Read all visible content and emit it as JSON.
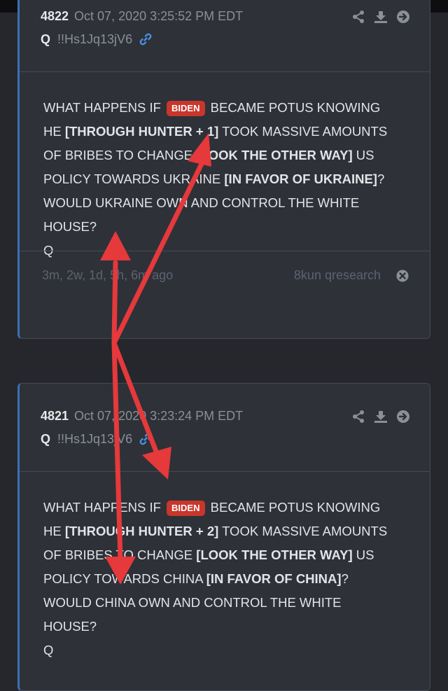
{
  "posts": [
    {
      "number": "4822",
      "date": "Oct 07, 2020 3:25:52 PM EDT",
      "author": "Q",
      "tripcode": "!!Hs1Jq13jV6",
      "body": {
        "l1_a": "WHAT HAPPENS IF",
        "badge": "BIDEN",
        "l1_b": "BECAME POTUS KNOWING",
        "l2_a": "HE",
        "l2_b": "[THROUGH HUNTER + 1]",
        "l2_c": "TOOK MASSIVE AMOUNTS",
        "l3_a": "OF BRIBES TO CHANGE",
        "l3_b": "[LOOK THE OTHER WAY]",
        "l3_c": "US",
        "l4_a": "POLICY TOWARDS UKRAINE",
        "l4_b": "[IN FAVOR OF UKRAINE]",
        "l4_c": "?",
        "l5": "WOULD UKRAINE OWN AND CONTROL THE WHITE",
        "l6": "HOUSE?",
        "sig": "Q"
      },
      "ago": "3m, 2w, 1d, 5h, 6m ago",
      "board": "8kun qresearch"
    },
    {
      "number": "4821",
      "date": "Oct 07, 2020 3:23:24 PM EDT",
      "author": "Q",
      "tripcode": "!!Hs1Jq13jV6",
      "body": {
        "l1_a": "WHAT HAPPENS IF",
        "badge": "BIDEN",
        "l1_b": "BECAME POTUS KNOWING",
        "l2_a": "HE",
        "l2_b": "[THROUGH HUNTER + 2]",
        "l2_c": "TOOK MASSIVE AMOUNTS",
        "l3_a": "OF BRIBES TO CHANGE",
        "l3_b": "[LOOK THE OTHER WAY]",
        "l3_c": "US",
        "l4_a": "POLICY TOWARDS CHINA",
        "l4_b": "[IN FAVOR OF CHINA]",
        "l4_c": "?",
        "l5": "WOULD CHINA OWN AND CONTROL THE WHITE",
        "l6": "HOUSE?",
        "sig": "Q"
      }
    }
  ],
  "icons": [
    "share-icon",
    "download-icon",
    "goto-icon",
    "link-icon",
    "close-icon"
  ],
  "colors": {
    "badge": "#c9362b",
    "arrow": "#e5393b",
    "accent": "#3b6fb6",
    "link": "#4a8fe0"
  }
}
